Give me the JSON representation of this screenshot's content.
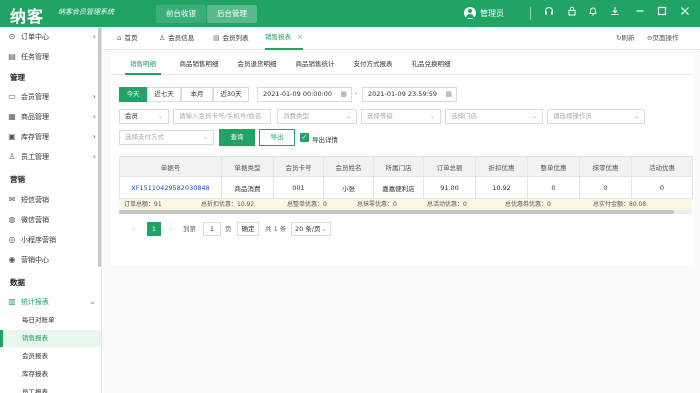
{
  "title_bar": {
    "logo": "纳客",
    "slogan": "纳客会员管理系统",
    "nav_front": "前台收银",
    "nav_back": "后台管理",
    "user_name": "管理员",
    "brand_color": "#21a366",
    "icons": [
      "headset-icon",
      "lock-icon",
      "bell-icon",
      "download-icon",
      "minimize-icon",
      "maximize-icon",
      "close-icon"
    ]
  },
  "sidebar": {
    "top_items": [
      {
        "label": "订单中心",
        "icon": "order-icon"
      },
      {
        "label": "任务管理",
        "icon": "task-icon"
      }
    ],
    "section_manage": "管理",
    "manage_items": [
      {
        "label": "会员管理",
        "icon": "member-icon"
      },
      {
        "label": "商品管理",
        "icon": "goods-icon"
      },
      {
        "label": "库存管理",
        "icon": "stock-icon"
      },
      {
        "label": "员工管理",
        "icon": "staff-icon"
      }
    ],
    "section_marketing": "营销",
    "marketing_items": [
      {
        "label": "短信营销",
        "icon": "sms-icon"
      },
      {
        "label": "微信营销",
        "icon": "wechat-icon"
      },
      {
        "label": "小程序营销",
        "icon": "miniapp-icon"
      },
      {
        "label": "营销中心",
        "icon": "marketing-icon"
      }
    ],
    "section_data": "数据",
    "report_group": "统计报表",
    "report_items": [
      "每日对账单",
      "销售报表",
      "会员报表",
      "库存报表",
      "员工报表"
    ],
    "active_item": "销售报表"
  },
  "page_tabs": {
    "tabs": [
      "首页",
      "会员信息",
      "会员列表",
      "销售报表"
    ],
    "active": "销售报表",
    "refresh": "刷新",
    "page_ops": "页面操作"
  },
  "sub_tabs": {
    "tabs": [
      "销售明细",
      "商品销售明细",
      "会员退货明细",
      "商品销售统计",
      "支付方式报表",
      "礼品兑换明细"
    ],
    "active": "销售明细"
  },
  "filters": {
    "date_buttons": [
      "今天",
      "近七天",
      "本月",
      "近30天"
    ],
    "active_date": "今天",
    "date_start": "2021-01-09 00:00:00",
    "date_end": "2021-01-09 23:59:59",
    "member_select": "会员",
    "member_placeholder": "请输入会员卡号/手机号/姓名",
    "consume_type_placeholder": "消费类型",
    "level_placeholder": "选择等级",
    "store_placeholder": "选择门店",
    "operator_placeholder": "请选择操作员",
    "payment_placeholder": "选择支付方式",
    "query_button": "查询",
    "export_button": "导出",
    "export_detail": "导出详情"
  },
  "table": {
    "columns": [
      "单据号",
      "单据类型",
      "会员卡号",
      "会员姓名",
      "所属门店",
      "订单总额",
      "折扣优惠",
      "整单优惠",
      "抹零优惠",
      "活动优惠"
    ],
    "rows": [
      [
        "XF15110429582030848",
        "商品消费",
        "001",
        "小张",
        "嘉嘉便利店",
        "91.00",
        "10.92",
        "0",
        "0",
        "0"
      ]
    ]
  },
  "summary": {
    "order_total": "订单总额：91",
    "discount_total": "总折扣优惠：10.92",
    "whole_discount": "总整单优惠：0",
    "round_discount": "总抹零优惠：0",
    "activity_discount": "总活动优惠：0",
    "coupon_discount": "总优惠券优惠：0",
    "paid_total": "总实付金额：80.08"
  },
  "pagination": {
    "goto_label": "到第",
    "page_input": "1",
    "page_unit": "页",
    "confirm": "确定",
    "total": "共 1 条",
    "page_size": "20 条/页",
    "current": "1"
  }
}
